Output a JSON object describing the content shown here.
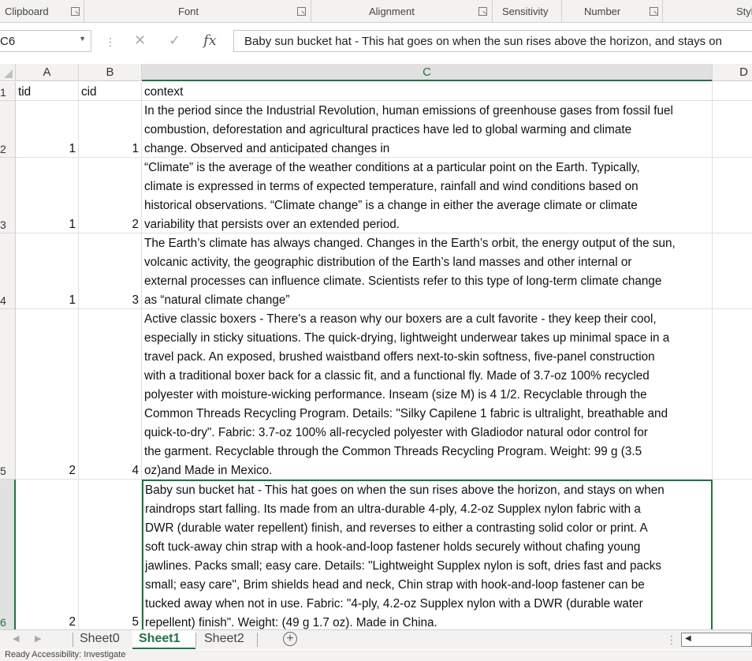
{
  "ribbon": {
    "groups": [
      {
        "label": "Clipboard"
      },
      {
        "label": "Font"
      },
      {
        "label": "Alignment"
      },
      {
        "label": "Sensitivity"
      },
      {
        "label": "Number"
      },
      {
        "label": "Styl"
      }
    ]
  },
  "formula_bar": {
    "name_box": "C6",
    "formula": "Baby sun bucket hat - This hat goes on when the sun rises above the horizon, and stays on"
  },
  "columns": [
    "A",
    "B",
    "C",
    "D"
  ],
  "selected_column": "C",
  "rows": [
    {
      "row_num": "1",
      "tid": "tid",
      "cid": "cid",
      "context": [
        "context"
      ]
    },
    {
      "row_num": "2",
      "tid": "1",
      "cid": "1",
      "context": [
        "In the period since the Industrial Revolution, human emissions of greenhouse gases from fossil fuel",
        "combustion, deforestation and agricultural practices have led to global warming and climate",
        "change. Observed and anticipated changes in"
      ]
    },
    {
      "row_num": "3",
      "tid": "1",
      "cid": "2",
      "context": [
        "“Climate” is the average of the weather conditions at a particular point on the Earth. Typically,",
        "climate is expressed in terms of expected temperature, rainfall and wind conditions based on",
        "historical observations. “Climate change” is a change in either the average climate or climate",
        "variability that persists over an extended period."
      ]
    },
    {
      "row_num": "4",
      "tid": "1",
      "cid": "3",
      "context": [
        "The Earth’s climate has always changed. Changes in the Earth’s orbit, the energy output of the sun,",
        "volcanic activity, the geographic distribution of the Earth’s land masses and other internal or",
        "external processes can influence climate. Scientists refer to this type of long-term climate change",
        "as “natural climate change”"
      ]
    },
    {
      "row_num": "5",
      "tid": "2",
      "cid": "4",
      "context": [
        "Active classic boxers - There's a reason why our boxers are a cult favorite - they keep their cool,",
        "especially in sticky situations. The quick-drying, lightweight underwear takes up minimal space in a",
        "travel pack. An exposed, brushed waistband offers next-to-skin softness, five-panel construction",
        "with a traditional boxer back for a classic fit, and a functional fly. Made of 3.7-oz 100% recycled",
        "polyester with moisture-wicking performance. Inseam (size M) is 4 1/2. Recyclable through the",
        "Common Threads Recycling Program. Details: \"Silky Capilene 1 fabric is ultralight, breathable and",
        "quick-to-dry\". Fabric: 3.7-oz 100% all-recycled polyester with Gladiodor natural odor control for",
        "the garment. Recyclable through the Common Threads Recycling Program. Weight: 99 g (3.5",
        "oz)and Made in Mexico."
      ]
    },
    {
      "row_num": "6",
      "tid": "2",
      "cid": "5",
      "context": [
        "Baby sun bucket hat - This hat goes on when the sun rises above the horizon, and stays on when",
        "raindrops start falling. Its made from an ultra-durable 4-ply, 4.2-oz Supplex nylon fabric with a",
        "DWR (durable water repellent) finish, and reverses to either a contrasting solid color or print. A",
        "soft tuck-away chin strap with a hook-and-loop fastener holds securely without chafing young",
        "jawlines. Packs small; easy care. Details: \"Lightweight Supplex nylon is soft, dries fast and packs",
        "small; easy care\", Brim shields head and neck, Chin strap with hook-and-loop fastener can be",
        "tucked away when not in use. Fabric: \"4-ply, 4.2-oz Supplex nylon with a DWR (durable water",
        "repellent) finish\". Weight: (49 g 1.7 oz). Made in China."
      ]
    }
  ],
  "sheets": {
    "tabs": [
      "Sheet0",
      "Sheet1",
      "Sheet2"
    ],
    "active": "Sheet1",
    "add_label": "+"
  },
  "status_bar": {
    "text": "Ready    Accessibility: Investigate"
  },
  "colors": {
    "accent": "#217346",
    "ribbon_bg": "#f3f2f1",
    "grid_line": "#e1e1e1"
  }
}
